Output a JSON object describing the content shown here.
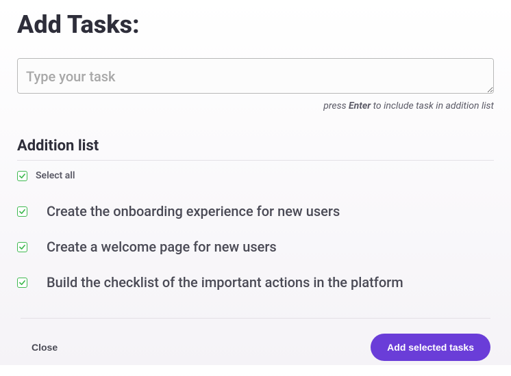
{
  "header": {
    "title": "Add Tasks:"
  },
  "input": {
    "placeholder": "Type your task",
    "value": ""
  },
  "hint": {
    "prefix": "press ",
    "key": "Enter",
    "suffix": " to include task in addition list"
  },
  "list": {
    "heading": "Addition list",
    "select_all_label": "Select all",
    "select_all_checked": true,
    "tasks": [
      {
        "text": "Create the onboarding experience for new users",
        "checked": true
      },
      {
        "text": "Create a welcome page for new users",
        "checked": true
      },
      {
        "text": "Build the checklist of the important actions in the platform",
        "checked": true
      }
    ]
  },
  "footer": {
    "close_label": "Close",
    "submit_label": "Add selected tasks"
  },
  "colors": {
    "accent": "#6a3dd8",
    "check": "#3FB950"
  }
}
